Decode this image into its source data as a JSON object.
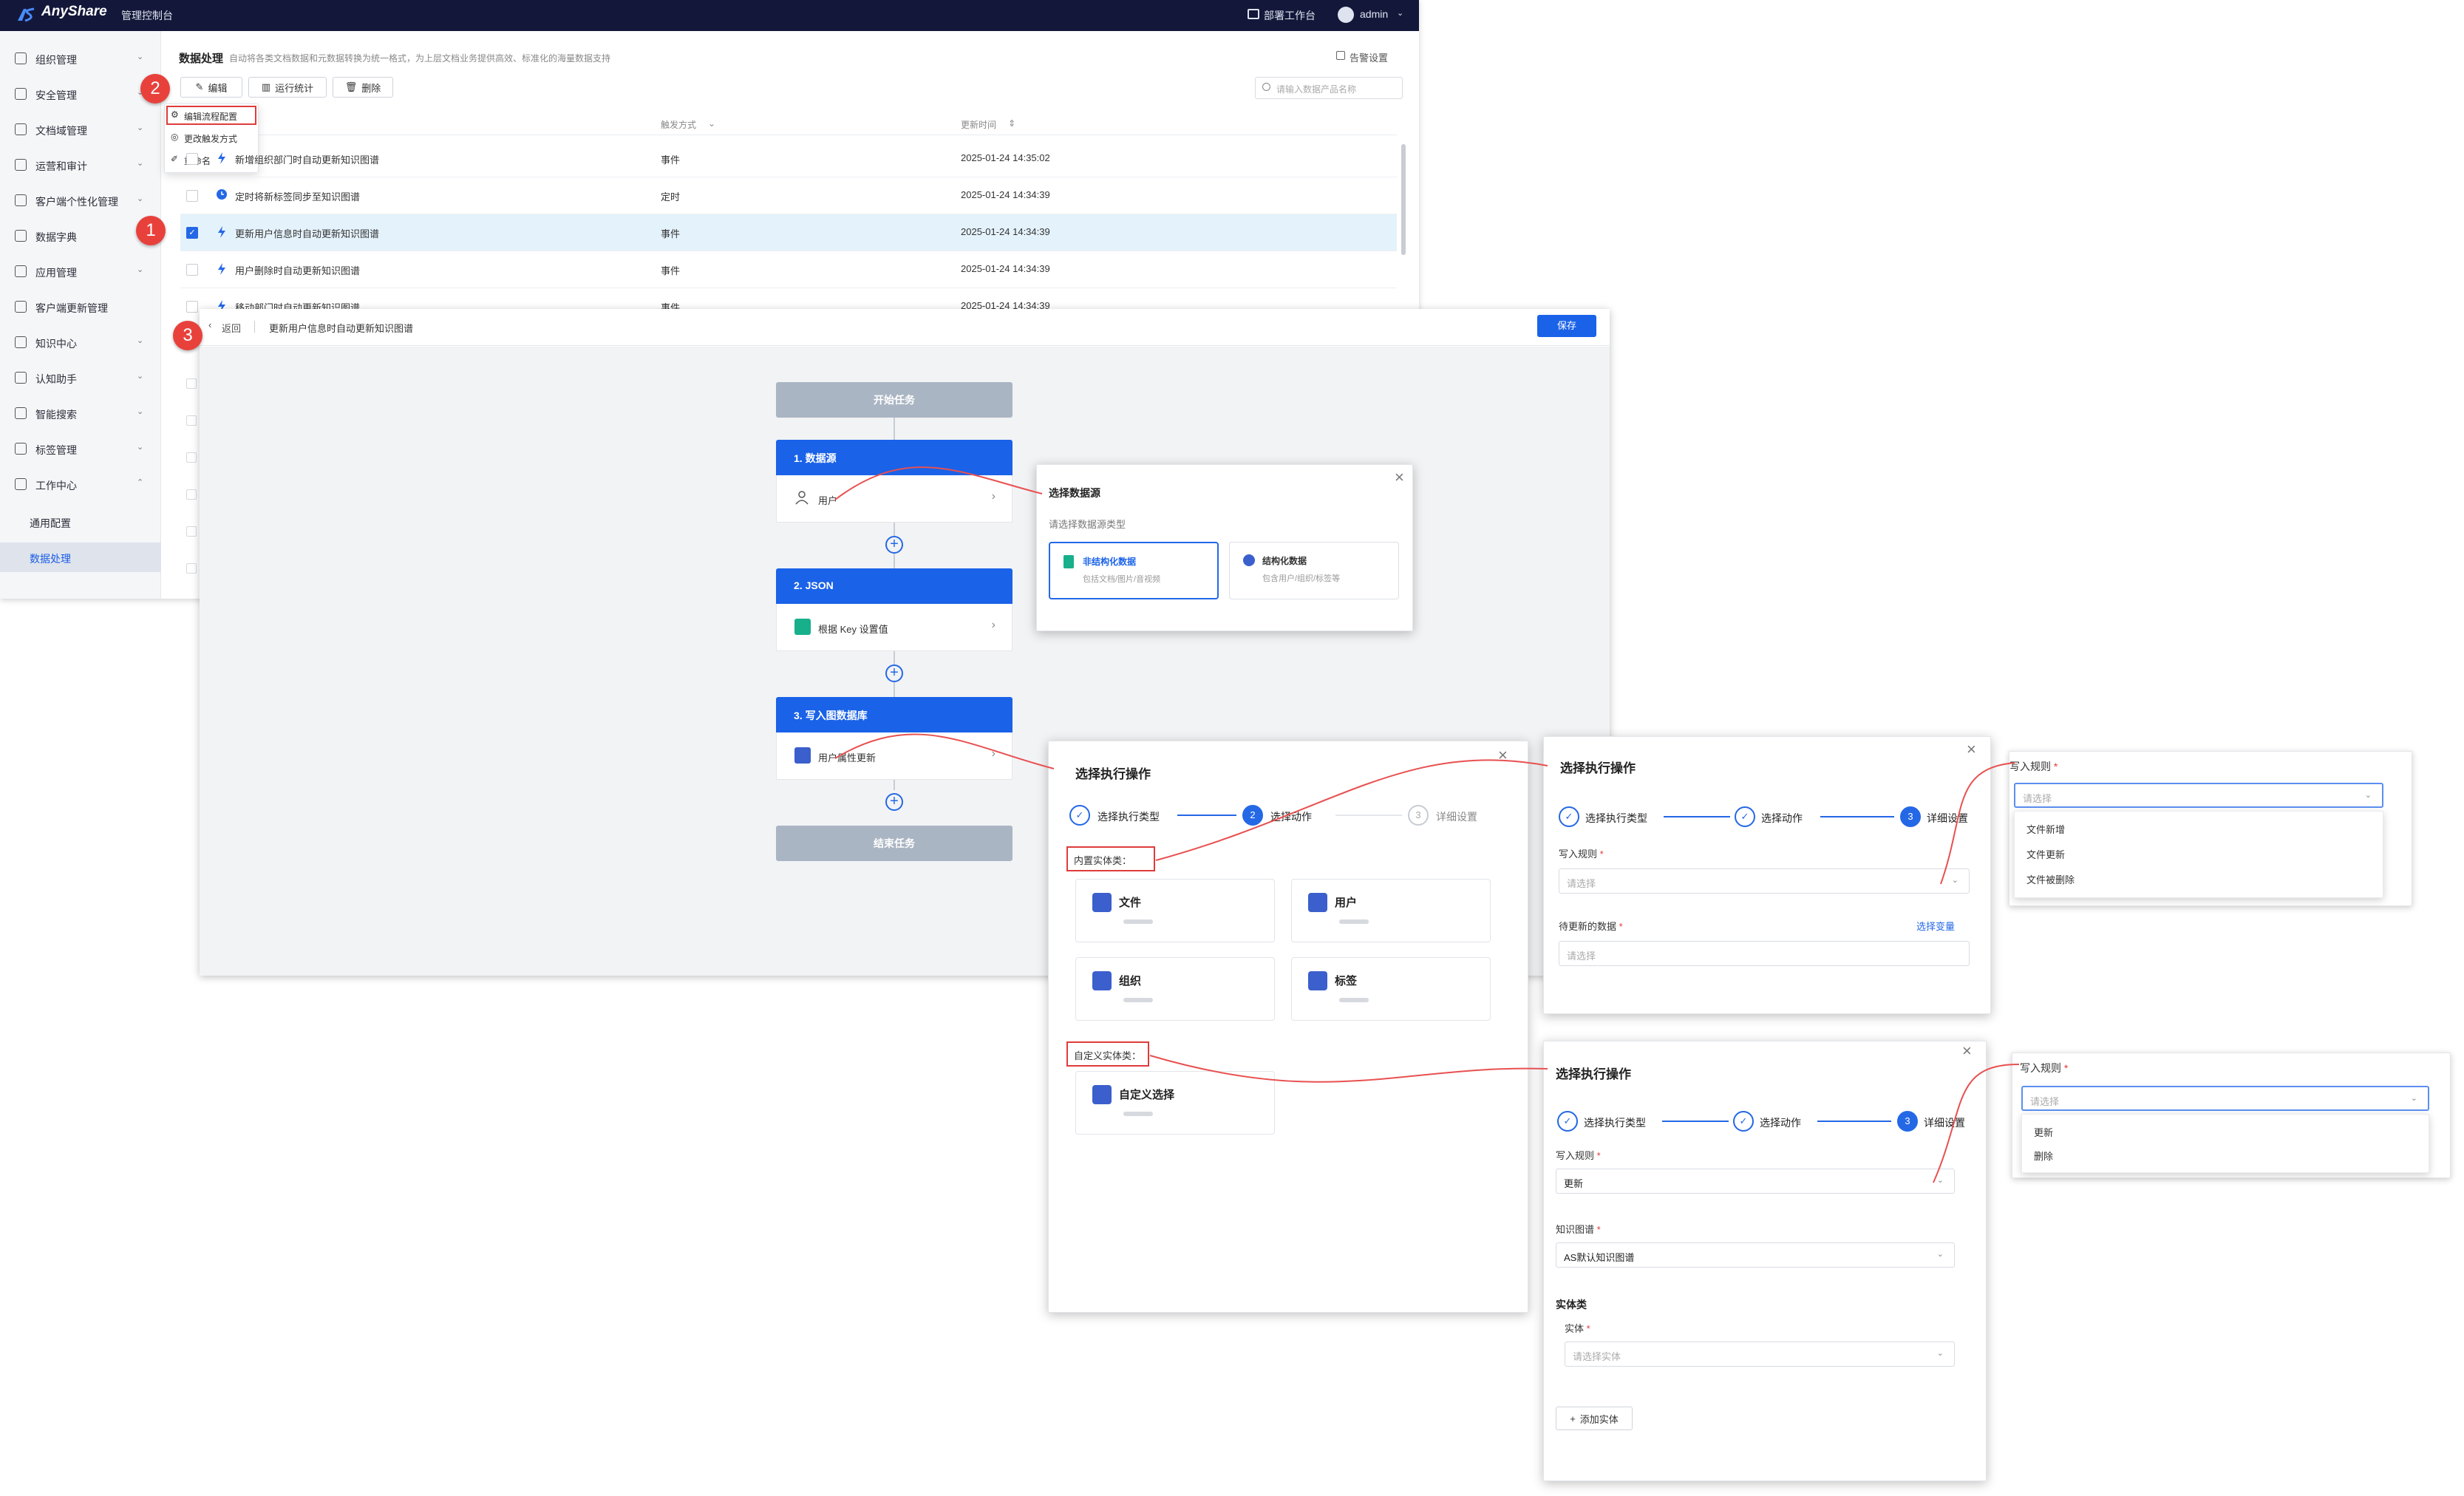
{
  "header": {
    "logo": "AnyShare",
    "subtitle": "管理控制台",
    "workbench": "部署工作台",
    "user": "admin"
  },
  "sidebar": {
    "items": [
      {
        "label": "组织管理",
        "chev": "⌄"
      },
      {
        "label": "安全管理",
        "chev": "⌄"
      },
      {
        "label": "文档域管理",
        "chev": "⌄"
      },
      {
        "label": "运营和审计",
        "chev": "⌄"
      },
      {
        "label": "客户端个性化管理",
        "chev": "⌄"
      },
      {
        "label": "数据字典",
        "chev": ""
      },
      {
        "label": "应用管理",
        "chev": "⌄"
      },
      {
        "label": "客户端更新管理",
        "chev": ""
      },
      {
        "label": "知识中心",
        "chev": "⌄"
      },
      {
        "label": "认知助手",
        "chev": "⌄"
      },
      {
        "label": "智能搜索",
        "chev": "⌄"
      },
      {
        "label": "标签管理",
        "chev": "⌄"
      },
      {
        "label": "工作中心",
        "chev": "⌃"
      }
    ],
    "sub_items": [
      "通用配置",
      "数据处理"
    ]
  },
  "page": {
    "title": "数据处理",
    "description": "自动将各类文档数据和元数据转换为统一格式，为上层文档业务提供高效、标准化的海量数据支持",
    "alert_settings": "告警设置",
    "toolbar": {
      "edit": "编辑",
      "stats": "运行统计",
      "delete": "删除"
    },
    "search_placeholder": "请输入数据产品名称",
    "columns": {
      "trigger": "触发方式",
      "updated": "更新时间"
    },
    "rows": [
      {
        "name": "新增组织部门时自动更新知识图谱",
        "trigger": "事件",
        "time": "2025-01-24 14:35:02"
      },
      {
        "name": "定时将新标签同步至知识图谱",
        "trigger": "定时",
        "time": "2025-01-24 14:34:39"
      },
      {
        "name": "更新用户信息时自动更新知识图谱",
        "trigger": "事件",
        "time": "2025-01-24 14:34:39"
      },
      {
        "name": "用户删除时自动更新知识图谱",
        "trigger": "事件",
        "time": "2025-01-24 14:34:39"
      },
      {
        "name": "移动部门时自动更新知识图谱",
        "trigger": "事件",
        "time": "2025-01-24 14:34:39"
      }
    ],
    "context_menu": [
      "编辑流程配置",
      "更改触发方式",
      "重命名"
    ]
  },
  "markers": [
    "1",
    "2",
    "3"
  ],
  "editor": {
    "back": "返回",
    "title": "更新用户信息时自动更新知识图谱",
    "save": "保存",
    "nodes": {
      "start": "开始任务",
      "n1_title": "1. 数据源",
      "n1_body": "用户",
      "n2_title": "2. JSON",
      "n2_body": "根据 Key 设置值",
      "n3_title": "3. 写入图数据库",
      "n3_body": "用户属性更新",
      "end": "结束任务"
    }
  },
  "datasource_panel": {
    "title": "选择数据源",
    "subtitle": "请选择数据源类型",
    "options": [
      {
        "title": "非结构化数据",
        "desc": "包括文档/图片/音视频"
      },
      {
        "title": "结构化数据",
        "desc": "包含用户/组织/标签等"
      }
    ]
  },
  "action_panel": {
    "title": "选择执行操作",
    "steps": [
      "选择执行类型",
      "选择动作",
      "详细设置"
    ],
    "builtin_label": "内置实体类：",
    "builtin": [
      "文件",
      "用户",
      "组织",
      "标签"
    ],
    "custom_label": "自定义实体类：",
    "custom": [
      "自定义选择"
    ]
  },
  "detail_panel_1": {
    "title": "选择执行操作",
    "steps": [
      "选择执行类型",
      "选择动作",
      "详细设置"
    ],
    "write_rule_label": "写入规则",
    "write_rule_placeholder": "请选择",
    "pending_label": "待更新的数据",
    "select_var": "选择变量",
    "pending_placeholder": "请选择"
  },
  "dropdown_1": {
    "label": "写入规则",
    "placeholder": "请选择",
    "options": [
      "文件新增",
      "文件更新",
      "文件被删除"
    ]
  },
  "detail_panel_2": {
    "title": "选择执行操作",
    "steps": [
      "选择执行类型",
      "选择动作",
      "详细设置"
    ],
    "write_rule_label": "写入规则",
    "write_rule_value": "更新",
    "graph_label": "知识图谱",
    "graph_value": "AS默认知识图谱",
    "entity_class": "实体类",
    "entity_label": "实体",
    "entity_placeholder": "请选择实体",
    "add_entity": "添加实体"
  },
  "dropdown_2": {
    "label": "写入规则",
    "placeholder": "请选择",
    "options": [
      "更新",
      "删除"
    ]
  },
  "colors": {
    "primary": "#1a62e8",
    "header": "#13183a",
    "marker": "#e8413c"
  }
}
